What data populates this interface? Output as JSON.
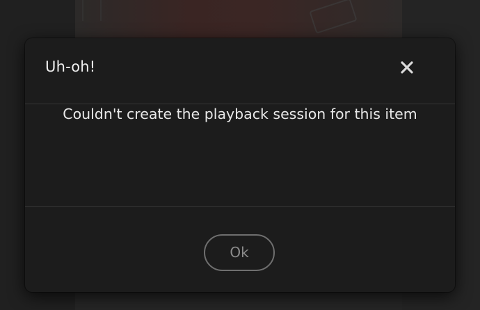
{
  "dialog": {
    "title": "Uh-oh!",
    "message": "Couldn't create the playback session for this item",
    "close_icon": "close-icon",
    "ok_label": "Ok"
  },
  "colors": {
    "dialog_background": "#1c1c1c",
    "title_text": "#efefef",
    "message_text": "#e8e8e8",
    "button_border": "#6f6f6f",
    "button_text": "#8c8c8c",
    "divider": "#353535"
  }
}
